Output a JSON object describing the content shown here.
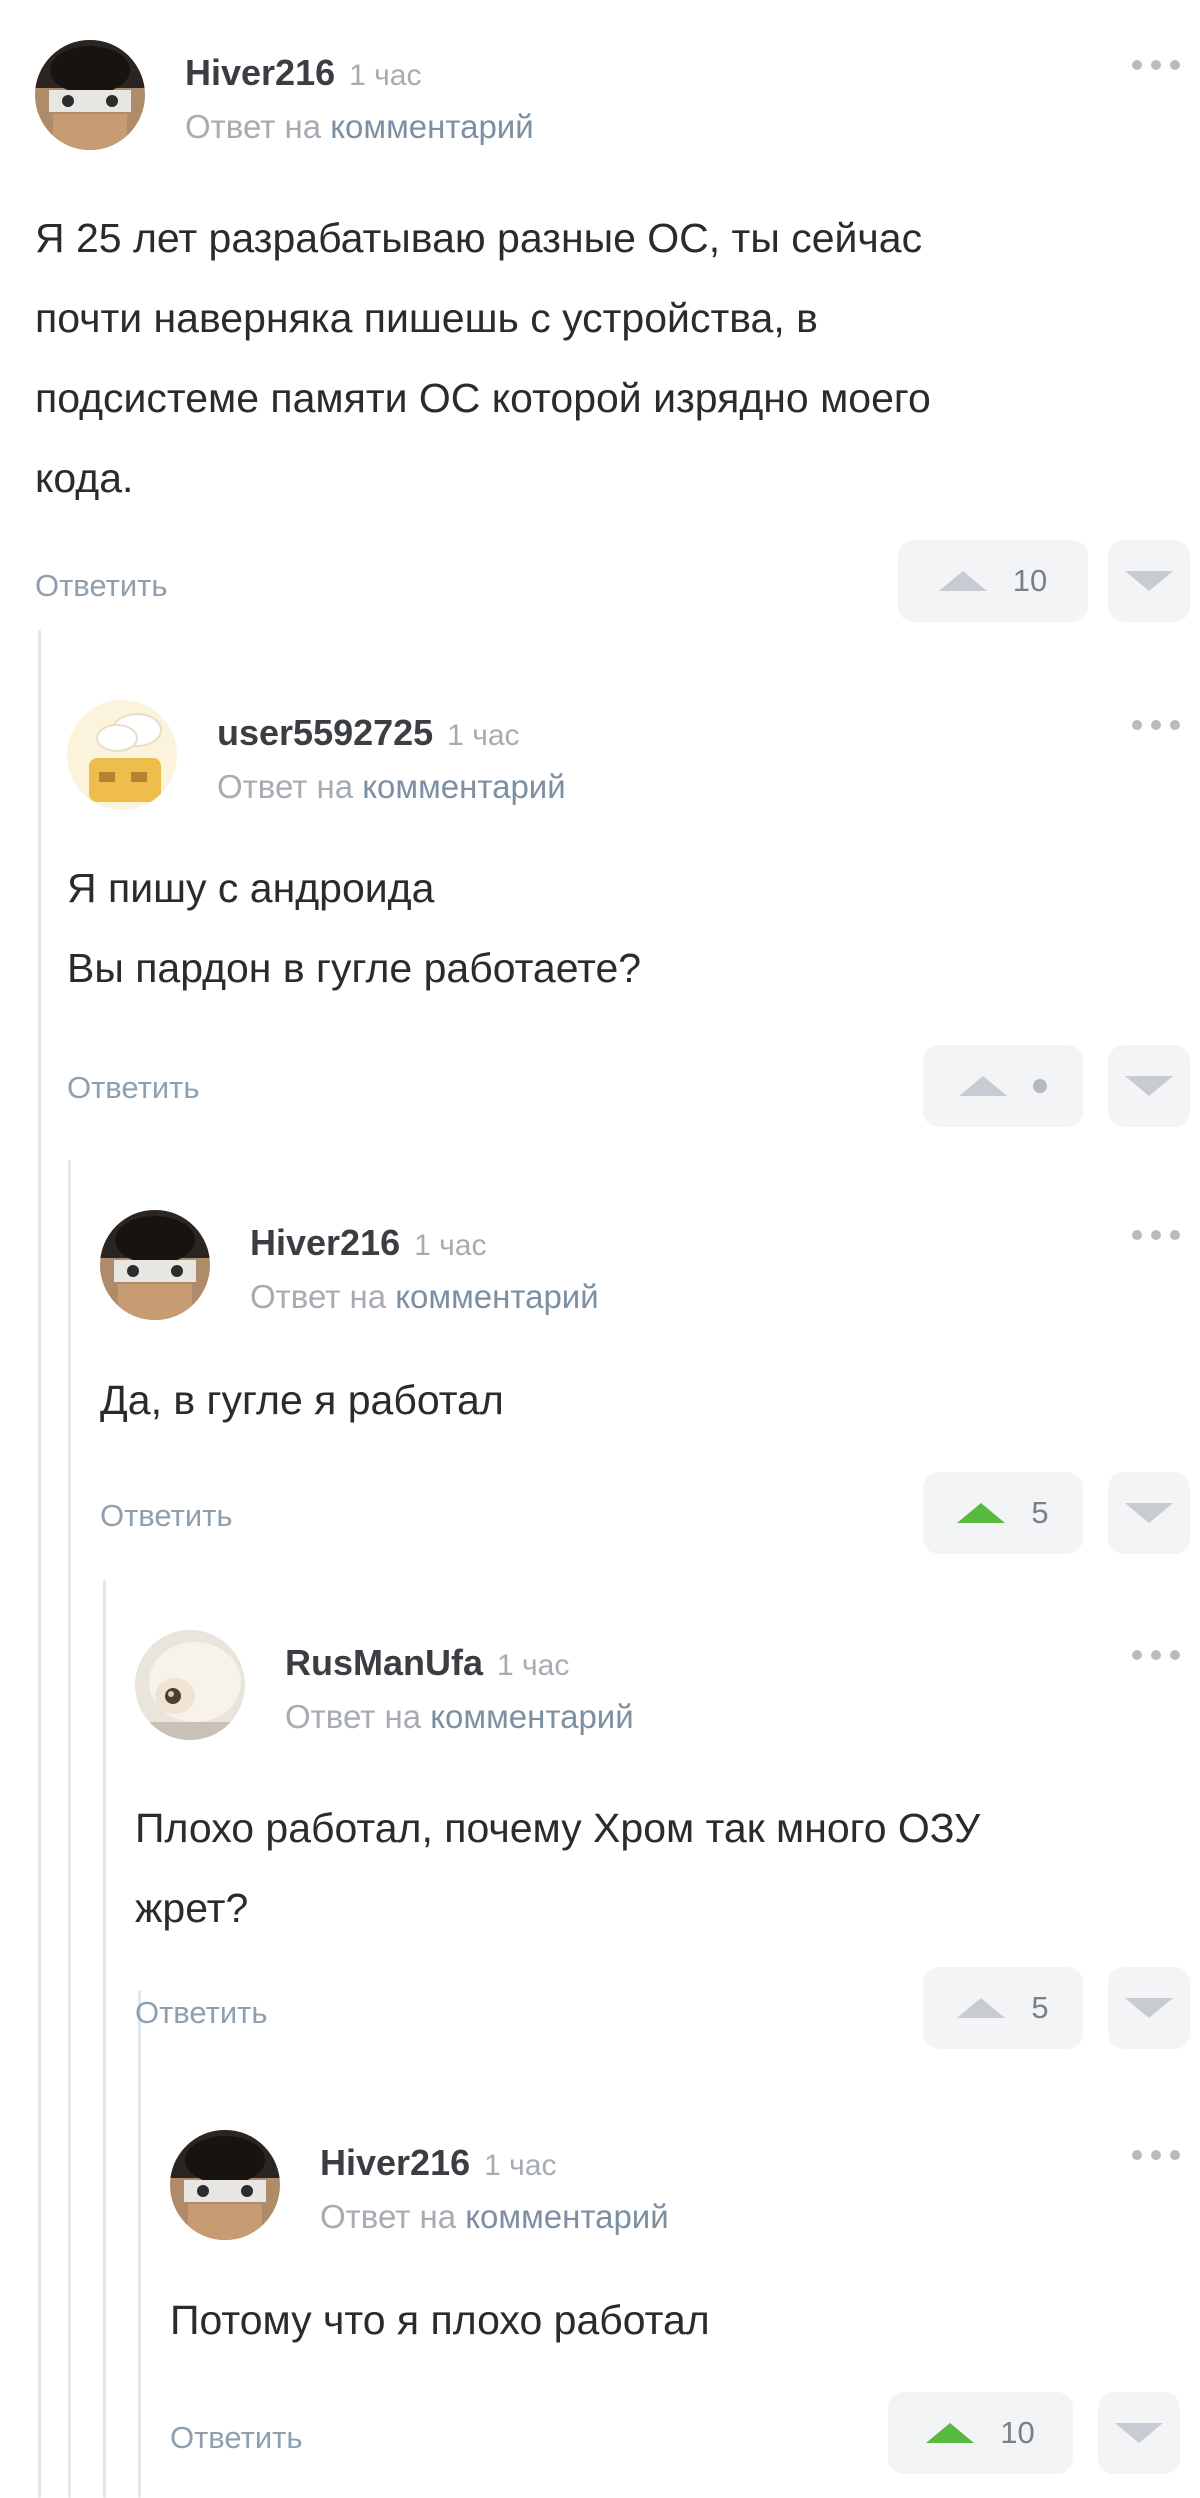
{
  "comments": [
    {
      "username": "Hiver216",
      "time": "1 час",
      "reply_prefix": "Ответ на",
      "reply_link": "комментарий",
      "lines": [
        "Я 25 лет разрабатываю разные ОС, ты сейчас",
        "почти наверняка пишешь с устройства, в",
        "подсистеме памяти ОС которой изрядно моего",
        "кода."
      ],
      "reply_label": "Ответить",
      "score": "10",
      "upvoted": false
    },
    {
      "username": "user5592725",
      "time": "1 час",
      "reply_prefix": "Ответ на",
      "reply_link": "комментарий",
      "lines": [
        "Я пишу с андроида",
        "Вы пардон в гугле работаете?"
      ],
      "reply_label": "Ответить",
      "score": null,
      "upvoted": false
    },
    {
      "username": "Hiver216",
      "time": "1 час",
      "reply_prefix": "Ответ на",
      "reply_link": "комментарий",
      "lines": [
        "Да, в гугле я работал"
      ],
      "reply_label": "Ответить",
      "score": "5",
      "upvoted": true
    },
    {
      "username": "RusManUfa",
      "time": "1 час",
      "reply_prefix": "Ответ на",
      "reply_link": "комментарий",
      "lines": [
        "Плохо работал, почему Хром так много ОЗУ",
        "жрет?"
      ],
      "reply_label": "Ответить",
      "score": "5",
      "upvoted": false
    },
    {
      "username": "Hiver216",
      "time": "1 час",
      "reply_prefix": "Ответ на",
      "reply_link": "комментарий",
      "lines": [
        "Потому что я плохо работал"
      ],
      "reply_label": "Ответить",
      "score": "10",
      "upvoted": true
    }
  ],
  "icons": {
    "more": "more-dots-icon",
    "upvote": "triangle-up-icon",
    "downvote": "triangle-down-icon"
  },
  "colors": {
    "upvote_active": "#57ba3e",
    "link": "#8ea0b0",
    "thread_line": "#e3e6ea"
  }
}
